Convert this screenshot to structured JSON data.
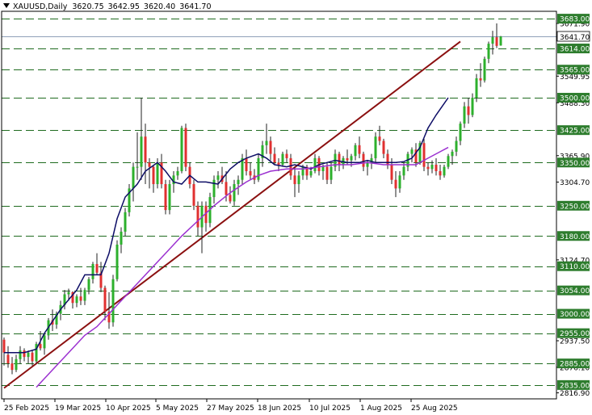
{
  "header": {
    "symbol": "XAUUSD,Daily",
    "open": "3620.75",
    "high": "3642.95",
    "low": "3620.40",
    "close": "3641.70"
  },
  "chart_data": {
    "type": "candlestick",
    "title": "XAUUSD,Daily",
    "ylim": [
      2803,
      3700
    ],
    "x_tick_labels": [
      "25 Feb 2025",
      "19 Mar 2025",
      "10 Apr 2025",
      "5 May 2025",
      "27 May 2025",
      "18 Jun 2025",
      "10 Jul 2025",
      "1 Aug 2025",
      "25 Aug 2025"
    ],
    "y_tick_labels": [
      "3671.90",
      "3549.95",
      "3488.30",
      "3365.90",
      "3304.70",
      "3124.70",
      "2937.50",
      "2876.10",
      "2816.90"
    ],
    "level_labels": [
      "3683.00",
      "3614.00",
      "3565.00",
      "3500.00",
      "3425.00",
      "3350.00",
      "3250.00",
      "3180.00",
      "3110.00",
      "3054.00",
      "3000.00",
      "2955.00",
      "2885.00",
      "2835.00"
    ],
    "current_price": "3641.70",
    "trendline": [
      [
        0,
        2828
      ],
      [
        113,
        3630
      ]
    ],
    "colors": {
      "bull": "#2db02d",
      "bear": "#e03030",
      "wick": "#222222",
      "level_line": "#1f6b1f",
      "level_label_bg": "#2e7d2e",
      "trendline": "#8b1010",
      "ma_fast": "#0d0d66",
      "ma_slow": "#9b30d0",
      "current_price_label": "#ffffff"
    },
    "indicators": [
      {
        "type": "moving_average",
        "color": "#0d0d66",
        "values": [
          [
            0,
            2910
          ],
          [
            5,
            2910
          ],
          [
            8,
            2918
          ],
          [
            10,
            2955
          ],
          [
            14,
            3010
          ],
          [
            18,
            3055
          ],
          [
            20,
            3090
          ],
          [
            22,
            3090
          ],
          [
            24,
            3090
          ],
          [
            26,
            3140
          ],
          [
            28,
            3220
          ],
          [
            30,
            3270
          ],
          [
            33,
            3300
          ],
          [
            35,
            3330
          ],
          [
            38,
            3350
          ],
          [
            40,
            3330
          ],
          [
            42,
            3305
          ],
          [
            44,
            3300
          ],
          [
            46,
            3320
          ],
          [
            48,
            3305
          ],
          [
            50,
            3305
          ],
          [
            53,
            3300
          ],
          [
            56,
            3335
          ],
          [
            58,
            3350
          ],
          [
            60,
            3360
          ],
          [
            63,
            3370
          ],
          [
            65,
            3360
          ],
          [
            67,
            3345
          ],
          [
            70,
            3340
          ],
          [
            72,
            3345
          ],
          [
            74,
            3340
          ],
          [
            76,
            3335
          ],
          [
            78,
            3345
          ],
          [
            80,
            3350
          ],
          [
            82,
            3355
          ],
          [
            85,
            3350
          ],
          [
            88,
            3350
          ],
          [
            90,
            3355
          ],
          [
            92,
            3350
          ],
          [
            95,
            3350
          ],
          [
            97,
            3350
          ],
          [
            99,
            3352
          ],
          [
            101,
            3360
          ],
          [
            103,
            3385
          ],
          [
            105,
            3430
          ],
          [
            107,
            3460
          ],
          [
            110,
            3500
          ]
        ]
      },
      {
        "type": "moving_average",
        "color": "#9b30d0",
        "values": [
          [
            8,
            2830
          ],
          [
            12,
            2870
          ],
          [
            16,
            2910
          ],
          [
            20,
            2950
          ],
          [
            23,
            2970
          ],
          [
            25,
            2990
          ],
          [
            28,
            3020
          ],
          [
            32,
            3060
          ],
          [
            36,
            3100
          ],
          [
            40,
            3140
          ],
          [
            44,
            3180
          ],
          [
            48,
            3215
          ],
          [
            52,
            3250
          ],
          [
            56,
            3280
          ],
          [
            60,
            3305
          ],
          [
            63,
            3320
          ],
          [
            66,
            3330
          ],
          [
            70,
            3335
          ],
          [
            74,
            3335
          ],
          [
            78,
            3340
          ],
          [
            82,
            3345
          ],
          [
            86,
            3345
          ],
          [
            90,
            3350
          ],
          [
            94,
            3345
          ],
          [
            98,
            3345
          ],
          [
            102,
            3345
          ],
          [
            105,
            3360
          ],
          [
            108,
            3375
          ],
          [
            110,
            3385
          ]
        ]
      }
    ],
    "candles": [
      [
        2940,
        2945,
        2880,
        2910
      ],
      [
        2905,
        2925,
        2875,
        2885
      ],
      [
        2885,
        2900,
        2860,
        2870
      ],
      [
        2870,
        2905,
        2865,
        2895
      ],
      [
        2895,
        2925,
        2885,
        2915
      ],
      [
        2915,
        2920,
        2890,
        2900
      ],
      [
        2900,
        2915,
        2885,
        2910
      ],
      [
        2910,
        2915,
        2880,
        2890
      ],
      [
        2890,
        2935,
        2885,
        2930
      ],
      [
        2930,
        2960,
        2915,
        2920
      ],
      [
        2920,
        2955,
        2905,
        2950
      ],
      [
        2950,
        2990,
        2940,
        2985
      ],
      [
        2985,
        3010,
        2960,
        2975
      ],
      [
        2975,
        3005,
        2965,
        3000
      ],
      [
        3000,
        3030,
        2985,
        3020
      ],
      [
        3020,
        3055,
        3010,
        3045
      ],
      [
        3045,
        3058,
        3030,
        3050
      ],
      [
        3050,
        3052,
        3012,
        3025
      ],
      [
        3025,
        3045,
        3015,
        3040
      ],
      [
        3040,
        3060,
        3020,
        3030
      ],
      [
        3030,
        3060,
        3020,
        3055
      ],
      [
        3055,
        3085,
        3045,
        3080
      ],
      [
        3080,
        3120,
        3070,
        3115
      ],
      [
        3115,
        3140,
        3090,
        3095
      ],
      [
        3095,
        3120,
        3050,
        3060
      ],
      [
        3060,
        3065,
        2985,
        3005
      ],
      [
        3005,
        3050,
        2965,
        2980
      ],
      [
        2980,
        3090,
        2970,
        3080
      ],
      [
        3080,
        3170,
        3075,
        3160
      ],
      [
        3160,
        3200,
        3140,
        3190
      ],
      [
        3190,
        3245,
        3180,
        3235
      ],
      [
        3235,
        3300,
        3225,
        3290
      ],
      [
        3290,
        3350,
        3260,
        3340
      ],
      [
        3340,
        3420,
        3310,
        3340
      ],
      [
        3340,
        3500,
        3310,
        3410
      ],
      [
        3410,
        3440,
        3300,
        3350
      ],
      [
        3350,
        3360,
        3290,
        3340
      ],
      [
        3340,
        3345,
        3280,
        3300
      ],
      [
        3300,
        3360,
        3290,
        3350
      ],
      [
        3350,
        3370,
        3290,
        3300
      ],
      [
        3300,
        3310,
        3230,
        3240
      ],
      [
        3240,
        3310,
        3230,
        3300
      ],
      [
        3300,
        3330,
        3280,
        3320
      ],
      [
        3320,
        3340,
        3310,
        3330
      ],
      [
        3330,
        3435,
        3325,
        3430
      ],
      [
        3430,
        3440,
        3330,
        3340
      ],
      [
        3340,
        3350,
        3290,
        3300
      ],
      [
        3300,
        3310,
        3240,
        3250
      ],
      [
        3250,
        3260,
        3180,
        3200
      ],
      [
        3200,
        3260,
        3140,
        3250
      ],
      [
        3250,
        3260,
        3190,
        3210
      ],
      [
        3210,
        3280,
        3200,
        3270
      ],
      [
        3270,
        3320,
        3255,
        3310
      ],
      [
        3310,
        3330,
        3290,
        3320
      ],
      [
        3320,
        3340,
        3300,
        3305
      ],
      [
        3305,
        3330,
        3260,
        3275
      ],
      [
        3275,
        3295,
        3255,
        3260
      ],
      [
        3260,
        3310,
        3250,
        3300
      ],
      [
        3300,
        3320,
        3275,
        3310
      ],
      [
        3310,
        3370,
        3300,
        3360
      ],
      [
        3360,
        3380,
        3320,
        3330
      ],
      [
        3330,
        3350,
        3310,
        3320
      ],
      [
        3320,
        3335,
        3300,
        3310
      ],
      [
        3310,
        3370,
        3305,
        3360
      ],
      [
        3360,
        3400,
        3340,
        3390
      ],
      [
        3390,
        3440,
        3370,
        3400
      ],
      [
        3400,
        3410,
        3355,
        3370
      ],
      [
        3370,
        3385,
        3345,
        3350
      ],
      [
        3350,
        3360,
        3330,
        3345
      ],
      [
        3345,
        3375,
        3340,
        3370
      ],
      [
        3370,
        3380,
        3350,
        3360
      ],
      [
        3360,
        3370,
        3310,
        3320
      ],
      [
        3320,
        3340,
        3270,
        3300
      ],
      [
        3300,
        3330,
        3280,
        3320
      ],
      [
        3320,
        3345,
        3310,
        3340
      ],
      [
        3340,
        3345,
        3310,
        3320
      ],
      [
        3320,
        3340,
        3315,
        3330
      ],
      [
        3330,
        3370,
        3325,
        3360
      ],
      [
        3360,
        3365,
        3320,
        3330
      ],
      [
        3330,
        3345,
        3310,
        3340
      ],
      [
        3340,
        3350,
        3300,
        3310
      ],
      [
        3310,
        3350,
        3300,
        3340
      ],
      [
        3340,
        3380,
        3330,
        3370
      ],
      [
        3370,
        3375,
        3330,
        3345
      ],
      [
        3345,
        3365,
        3335,
        3360
      ],
      [
        3360,
        3380,
        3345,
        3355
      ],
      [
        3355,
        3370,
        3340,
        3365
      ],
      [
        3365,
        3395,
        3355,
        3390
      ],
      [
        3390,
        3410,
        3360,
        3370
      ],
      [
        3370,
        3375,
        3330,
        3340
      ],
      [
        3340,
        3355,
        3320,
        3350
      ],
      [
        3350,
        3370,
        3335,
        3360
      ],
      [
        3360,
        3420,
        3350,
        3410
      ],
      [
        3410,
        3435,
        3390,
        3400
      ],
      [
        3400,
        3405,
        3360,
        3370
      ],
      [
        3370,
        3380,
        3335,
        3345
      ],
      [
        3345,
        3360,
        3300,
        3310
      ],
      [
        3310,
        3330,
        3270,
        3290
      ],
      [
        3290,
        3330,
        3280,
        3320
      ],
      [
        3320,
        3350,
        3310,
        3340
      ],
      [
        3340,
        3375,
        3330,
        3370
      ],
      [
        3370,
        3385,
        3350,
        3380
      ],
      [
        3380,
        3395,
        3340,
        3350
      ],
      [
        3350,
        3400,
        3345,
        3395
      ],
      [
        3395,
        3405,
        3330,
        3340
      ],
      [
        3340,
        3350,
        3320,
        3335
      ],
      [
        3335,
        3355,
        3325,
        3345
      ],
      [
        3345,
        3360,
        3320,
        3330
      ],
      [
        3330,
        3345,
        3310,
        3320
      ],
      [
        3320,
        3345,
        3315,
        3340
      ],
      [
        3340,
        3370,
        3335,
        3365
      ],
      [
        3365,
        3380,
        3345,
        3375
      ],
      [
        3375,
        3410,
        3365,
        3400
      ],
      [
        3400,
        3445,
        3390,
        3440
      ],
      [
        3440,
        3490,
        3430,
        3480
      ],
      [
        3480,
        3500,
        3440,
        3460
      ],
      [
        3460,
        3510,
        3455,
        3500
      ],
      [
        3500,
        3555,
        3490,
        3545
      ],
      [
        3545,
        3580,
        3525,
        3540
      ],
      [
        3540,
        3595,
        3535,
        3590
      ],
      [
        3590,
        3630,
        3580,
        3625
      ],
      [
        3625,
        3655,
        3600,
        3640
      ],
      [
        3640,
        3672,
        3615,
        3620
      ],
      [
        3620.75,
        3642.95,
        3620.4,
        3641.7
      ]
    ]
  }
}
